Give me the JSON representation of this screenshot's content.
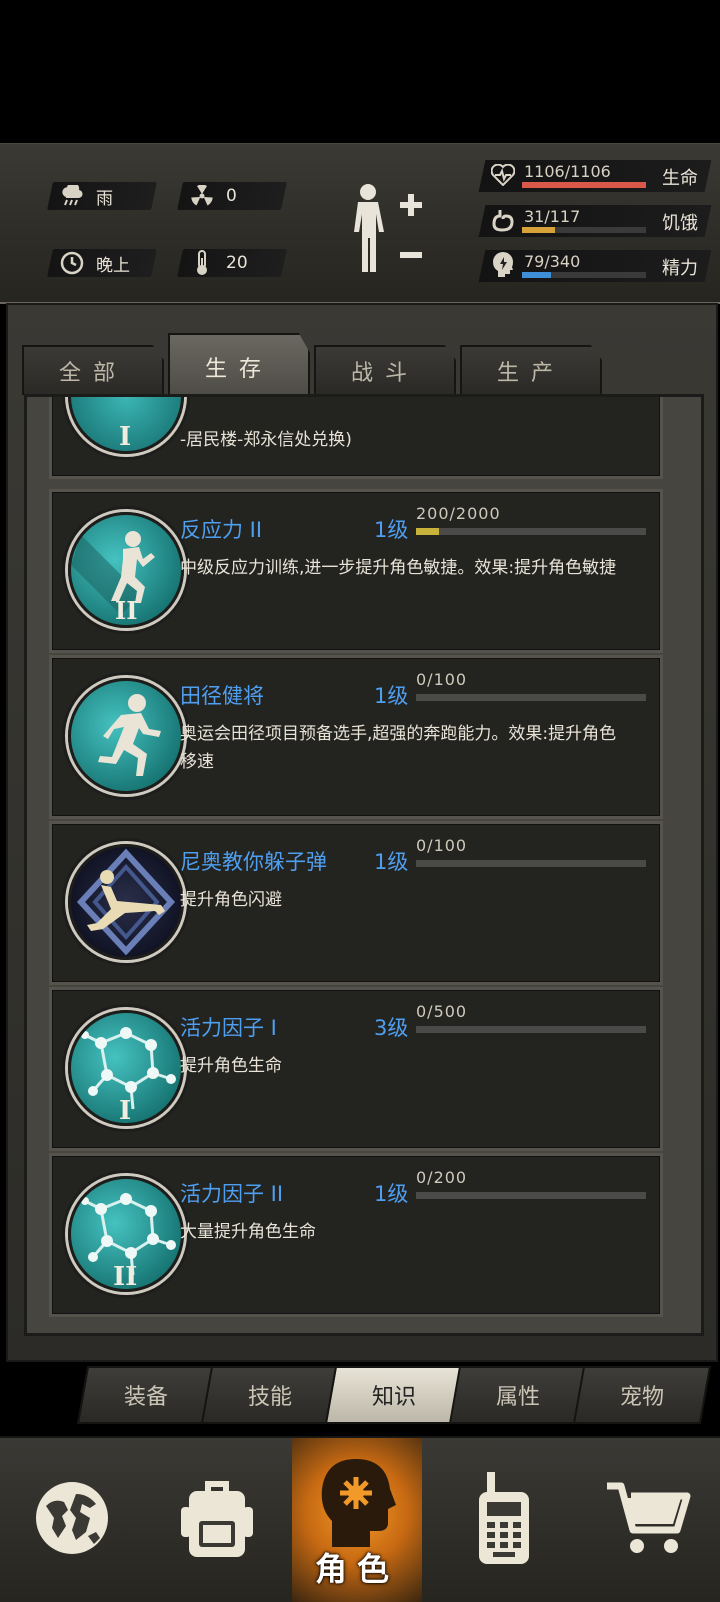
{
  "status": {
    "weather": {
      "icon": "rain-cloud-icon",
      "label": "雨"
    },
    "radiation": {
      "icon": "radiation-icon",
      "value": "0"
    },
    "time": {
      "icon": "clock-icon",
      "label": "晚上"
    },
    "temperature": {
      "icon": "thermometer-icon",
      "value": "20"
    },
    "bars": [
      {
        "icon": "heart-icon",
        "value": "1106/1106",
        "label": "生命",
        "fraction": 1.0,
        "color": "#d9584a"
      },
      {
        "icon": "stomach-icon",
        "value": "31/117",
        "label": "饥饿",
        "fraction": 0.265,
        "color": "#d8a23a"
      },
      {
        "icon": "energy-head-icon",
        "value": "79/340",
        "label": "精力",
        "fraction": 0.232,
        "color": "#3f8fd8"
      }
    ]
  },
  "category_tabs": [
    "全部",
    "生存",
    "战斗",
    "生产"
  ],
  "active_category": 1,
  "partial_item": {
    "desc": "-居民楼-郑永信处兑换)"
  },
  "skills": [
    {
      "name": "反应力 II",
      "level": "1级",
      "xp": "200/2000",
      "progress": 0.1,
      "desc": "中级反应力训练,进一步提升角色敏捷。效果:提升角色敏捷",
      "icon": "agility-pose-icon"
    },
    {
      "name": "田径健将",
      "level": "1级",
      "xp": "0/100",
      "progress": 0,
      "desc": "奥运会田径项目预备选手,超强的奔跑能力。效果:提升角色移速",
      "icon": "running-icon"
    },
    {
      "name": "尼奥教你躲子弹",
      "level": "1级",
      "xp": "0/100",
      "progress": 0,
      "desc": "提升角色闪避",
      "icon": "dodge-pose-icon"
    },
    {
      "name": "活力因子 I",
      "level": "3级",
      "xp": "0/500",
      "progress": 0,
      "desc": "提升角色生命",
      "icon": "molecule-icon"
    },
    {
      "name": "活力因子 II",
      "level": "1级",
      "xp": "0/200",
      "progress": 0,
      "desc": "大量提升角色生命",
      "icon": "molecule-icon"
    }
  ],
  "sub_tabs": [
    "装备",
    "技能",
    "知识",
    "属性",
    "宠物"
  ],
  "active_sub_tab": 2,
  "bottom_nav": {
    "items": [
      "globe-icon",
      "backpack-icon",
      "character-head-icon",
      "walkie-talkie-icon",
      "shopping-cart-icon"
    ],
    "active_label": "角色"
  }
}
